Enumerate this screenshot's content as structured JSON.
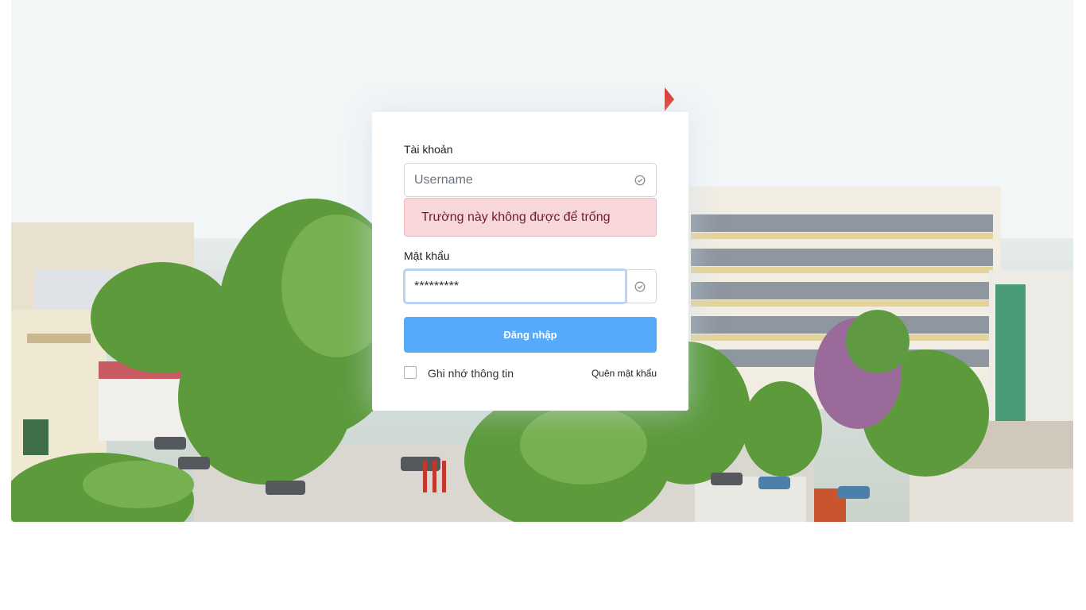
{
  "login_form": {
    "username_label": "Tài khoản",
    "username_placeholder": "Username",
    "username_value": "",
    "error_message": "Trường này không được để trống",
    "password_label": "Mật khẩu",
    "password_value": "*********",
    "login_button_label": "Đăng nhập",
    "remember_label": "Ghi nhớ thông tin",
    "remember_checked": false,
    "forgot_password_label": "Quên mật khẩu"
  },
  "colors": {
    "primary_button": "#57a9fb",
    "error_background": "#f8d7da",
    "error_text": "#721c24"
  },
  "icons": {
    "field_status": "check-circle-icon"
  }
}
